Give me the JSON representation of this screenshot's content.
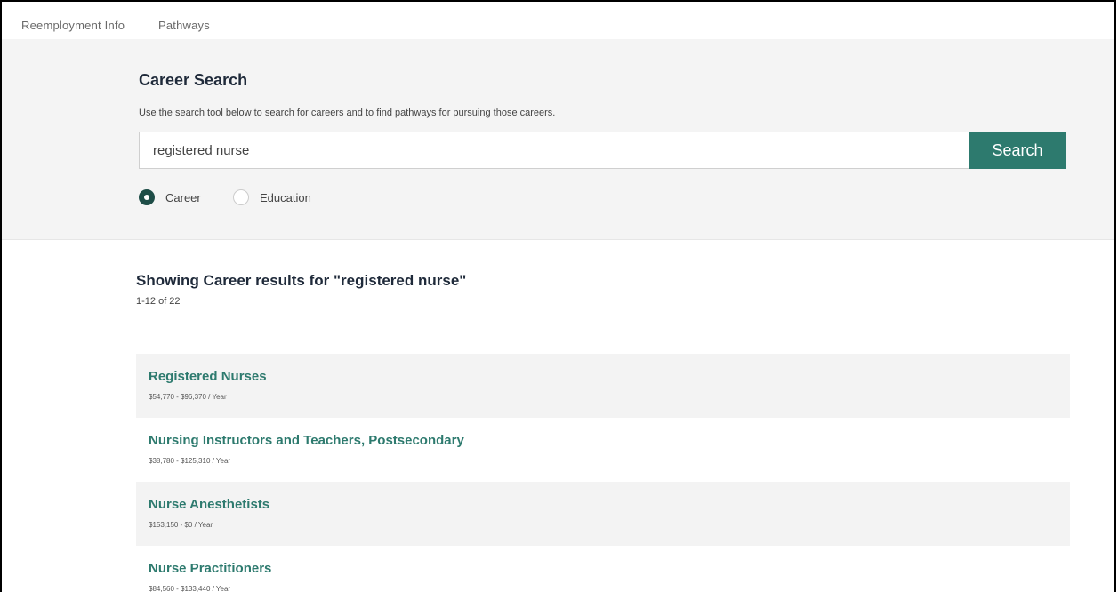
{
  "nav": {
    "items": [
      {
        "label": "Reemployment Info"
      },
      {
        "label": "Pathways"
      }
    ]
  },
  "search": {
    "title": "Career Search",
    "description": "Use the search tool below to search for careers and to find pathways for pursuing those careers.",
    "value": "registered nurse",
    "button_label": "Search",
    "options": [
      {
        "label": "Career",
        "selected": true
      },
      {
        "label": "Education",
        "selected": false
      }
    ]
  },
  "results": {
    "heading": "Showing Career results for \"registered nurse\"",
    "count": "1-12 of 22",
    "items": [
      {
        "name": "Registered Nurses",
        "salary": "$54,770 - $96,370 / Year"
      },
      {
        "name": "Nursing Instructors and Teachers, Postsecondary",
        "salary": "$38,780 - $125,310 / Year"
      },
      {
        "name": "Nurse Anesthetists",
        "salary": "$153,150 - $0 / Year"
      },
      {
        "name": "Nurse Practitioners",
        "salary": "$84,560 - $133,440 / Year"
      }
    ]
  },
  "colors": {
    "accent": "#2d7a6e",
    "heading": "#1f2a3a",
    "band_bg": "#f4f4f4"
  }
}
